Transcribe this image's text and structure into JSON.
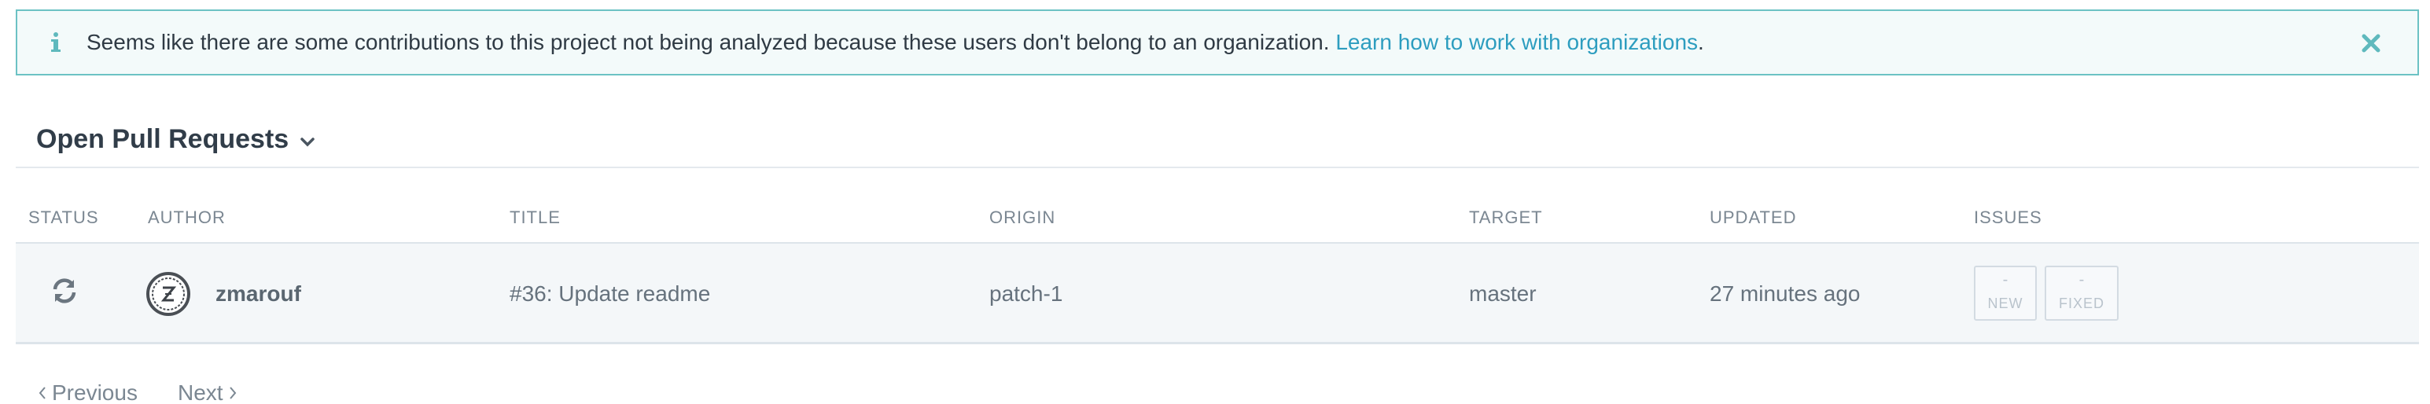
{
  "banner": {
    "message": "Seems like there are some contributions to this project not being analyzed because these users don't belong to an organization.",
    "link_text": "Learn how to work with organizations",
    "suffix": ".",
    "accent_color": "#6cc2c4",
    "icon": "info-icon",
    "close_icon": "close-icon"
  },
  "section": {
    "title": "Open Pull Requests",
    "icon": "chevron-down-icon"
  },
  "table": {
    "columns": [
      "STATUS",
      "AUTHOR",
      "TITLE",
      "ORIGIN",
      "TARGET",
      "UPDATED",
      "ISSUES"
    ],
    "rows": [
      {
        "status_icon": "sync-icon",
        "author": "zmarouf",
        "title": "#36: Update readme",
        "origin": "patch-1",
        "target": "master",
        "updated": "27 minutes ago",
        "issues_new_value": "-",
        "issues_new_label": "NEW",
        "issues_fixed_value": "-",
        "issues_fixed_label": "FIXED"
      }
    ]
  },
  "pagination": {
    "previous": "Previous",
    "next": "Next"
  }
}
